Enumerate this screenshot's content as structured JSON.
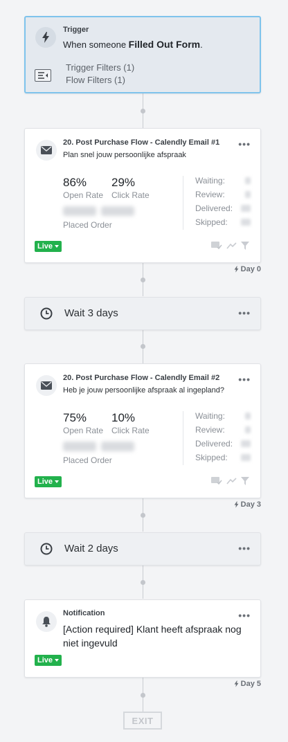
{
  "trigger": {
    "label": "Trigger",
    "text_prefix": "When someone ",
    "text_bold": "Filled Out Form",
    "text_suffix": ".",
    "filters": [
      "Trigger Filters (1)",
      "Flow Filters (1)"
    ]
  },
  "emails": [
    {
      "title": "20. Post Purchase Flow - Calendly Email #1",
      "subject": "Plan snel jouw persoonlijke afspraak",
      "open_rate": "86%",
      "click_rate": "29%",
      "open_label": "Open Rate",
      "click_label": "Click Rate",
      "placed_order_label": "Placed Order",
      "side_labels": [
        "Waiting:",
        "Review:",
        "Delivered:",
        "Skipped:"
      ],
      "status": "Live",
      "day_label": "Day 0"
    },
    {
      "title": "20. Post Purchase Flow - Calendly Email #2",
      "subject": "Heb je jouw persoonlijke afspraak al ingepland?",
      "open_rate": "75%",
      "click_rate": "10%",
      "open_label": "Open Rate",
      "click_label": "Click Rate",
      "placed_order_label": "Placed Order",
      "side_labels": [
        "Waiting:",
        "Review:",
        "Delivered:",
        "Skipped:"
      ],
      "status": "Live",
      "day_label": "Day 3"
    }
  ],
  "waits": [
    {
      "label": "Wait 3 days"
    },
    {
      "label": "Wait 2 days"
    }
  ],
  "notification": {
    "label": "Notification",
    "text": "[Action required] Klant heeft afspraak nog niet ingevuld",
    "status": "Live",
    "day_label": "Day 5"
  },
  "exit_label": "EXIT",
  "more_label": "•••",
  "colors": {
    "live": "#22b14c",
    "trigger_border": "#7ec3ec",
    "trigger_bg": "#e4e9ef"
  }
}
